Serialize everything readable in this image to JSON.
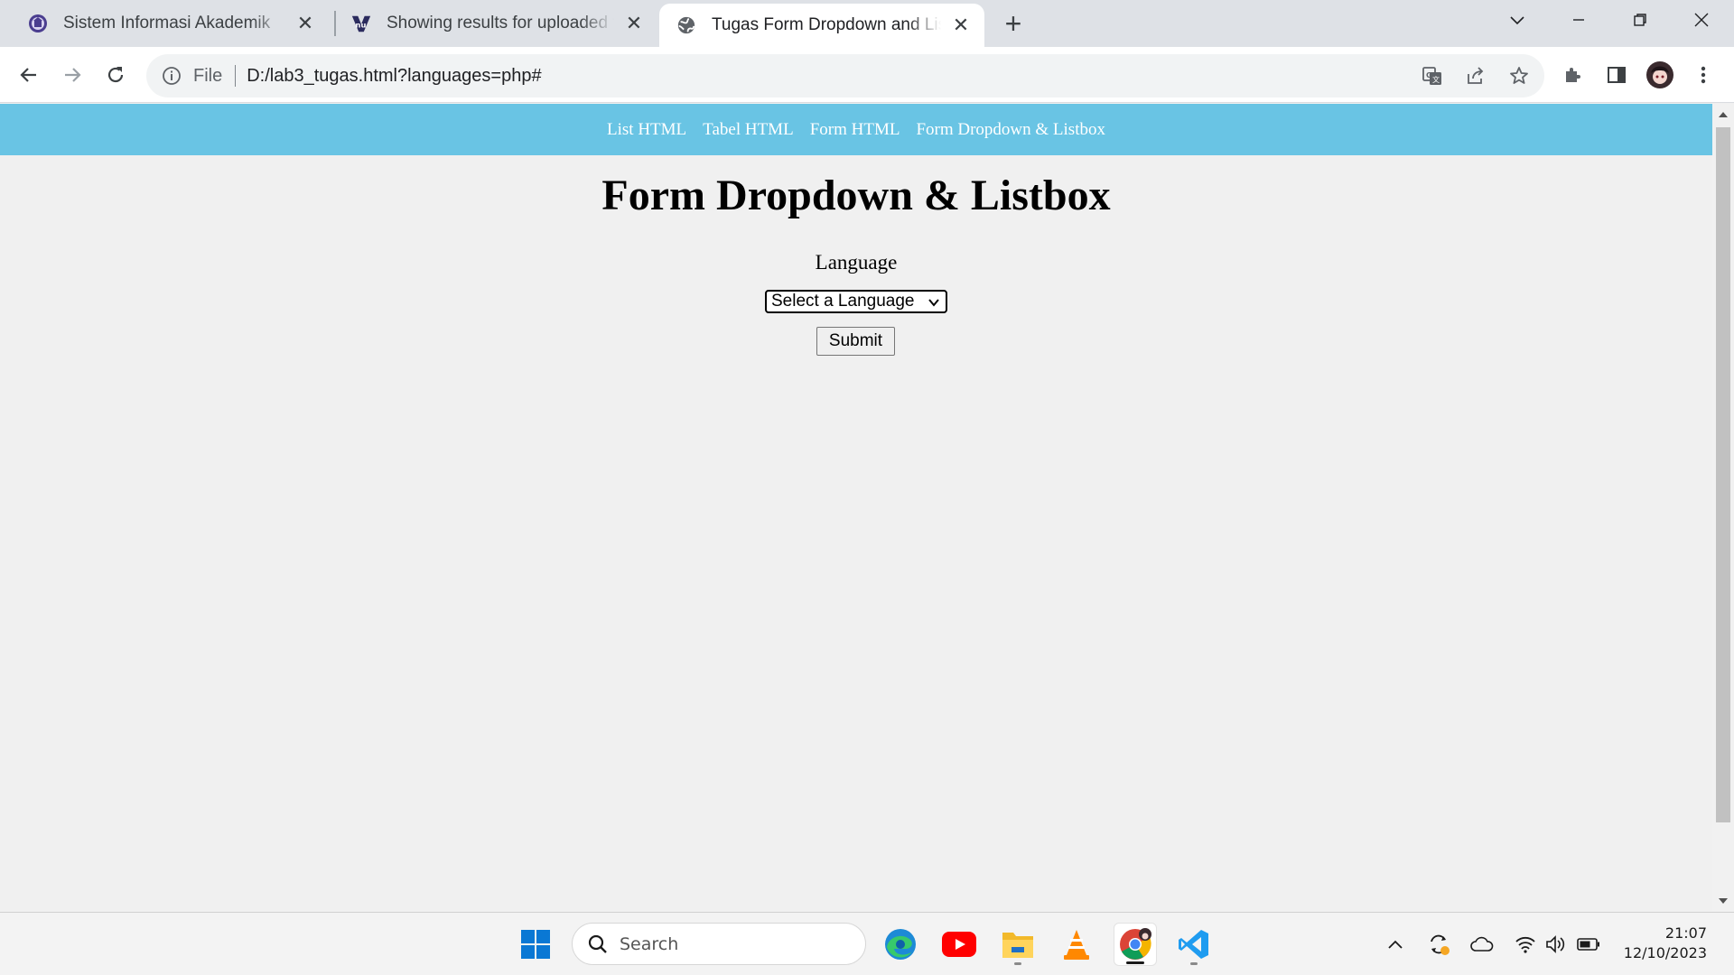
{
  "browser": {
    "tabs": [
      {
        "title": "Sistem Informasi Akademik",
        "favicon": "university-logo-icon",
        "active": false
      },
      {
        "title": "Showing results for uploaded file",
        "favicon": "nu-logo-icon",
        "active": false
      },
      {
        "title": "Tugas Form Dropdown and Listbox",
        "favicon": "globe-icon",
        "active": true
      }
    ],
    "address": {
      "scheme_label": "File",
      "url": "D:/lab3_tugas.html?languages=php#"
    },
    "colors": {
      "tabstrip": "#dee1e6",
      "toolbar": "#ffffff",
      "omnibox": "#f1f3f4"
    }
  },
  "page": {
    "nav": [
      {
        "label": "List HTML"
      },
      {
        "label": "Tabel HTML"
      },
      {
        "label": "Form HTML"
      },
      {
        "label": "Form Dropdown & Listbox"
      }
    ],
    "nav_color": "#69c4e4",
    "title": "Form Dropdown & Listbox",
    "form": {
      "label": "Language",
      "select_value": "Select a Language",
      "submit_label": "Submit"
    }
  },
  "taskbar": {
    "search_placeholder": "Search",
    "apps": [
      "windows-start-icon",
      "edge-icon",
      "youtube-icon",
      "file-explorer-icon",
      "vlc-icon",
      "chrome-icon",
      "vscode-icon"
    ],
    "clock": {
      "time": "21:07",
      "date": "12/10/2023"
    }
  }
}
